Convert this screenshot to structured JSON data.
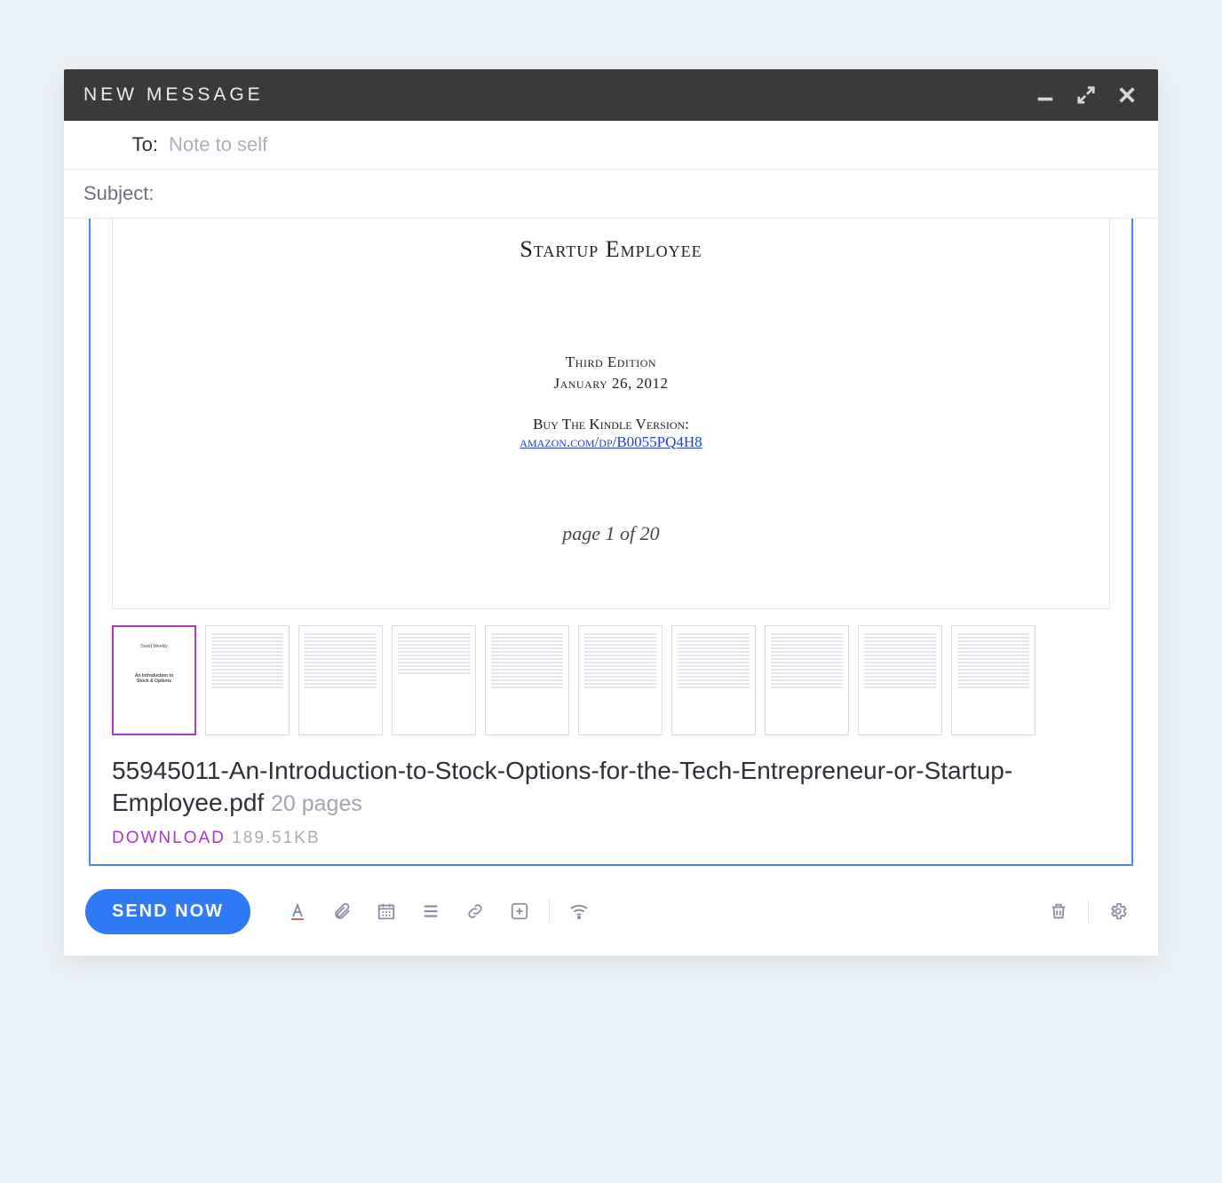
{
  "window": {
    "title": "NEW MESSAGE"
  },
  "to": {
    "label": "To:",
    "placeholder": "Note to self"
  },
  "subject": {
    "label": "Subject:"
  },
  "attachment": {
    "preview": {
      "doc_title_line": "Startup Employee",
      "edition_line1": "Third Edition",
      "edition_line2": "January 26, 2012",
      "kindle_label": "Buy The Kindle Version:",
      "kindle_url_text": "amazon.com/dp/B0055PQ4H8",
      "page_counter": "page 1 of 20"
    },
    "thumb_cover": {
      "author": "David Weekly",
      "title1": "An Introduction to",
      "title2": "Stock & Options"
    },
    "filename": "55945011-An-Introduction-to-Stock-Options-for-the-Tech-Entrepreneur-or-Startup-Employee.pdf",
    "pages_label": "20 pages",
    "download_label": "DOWNLOAD",
    "size": "189.51KB"
  },
  "toolbar": {
    "send": "SEND NOW"
  }
}
